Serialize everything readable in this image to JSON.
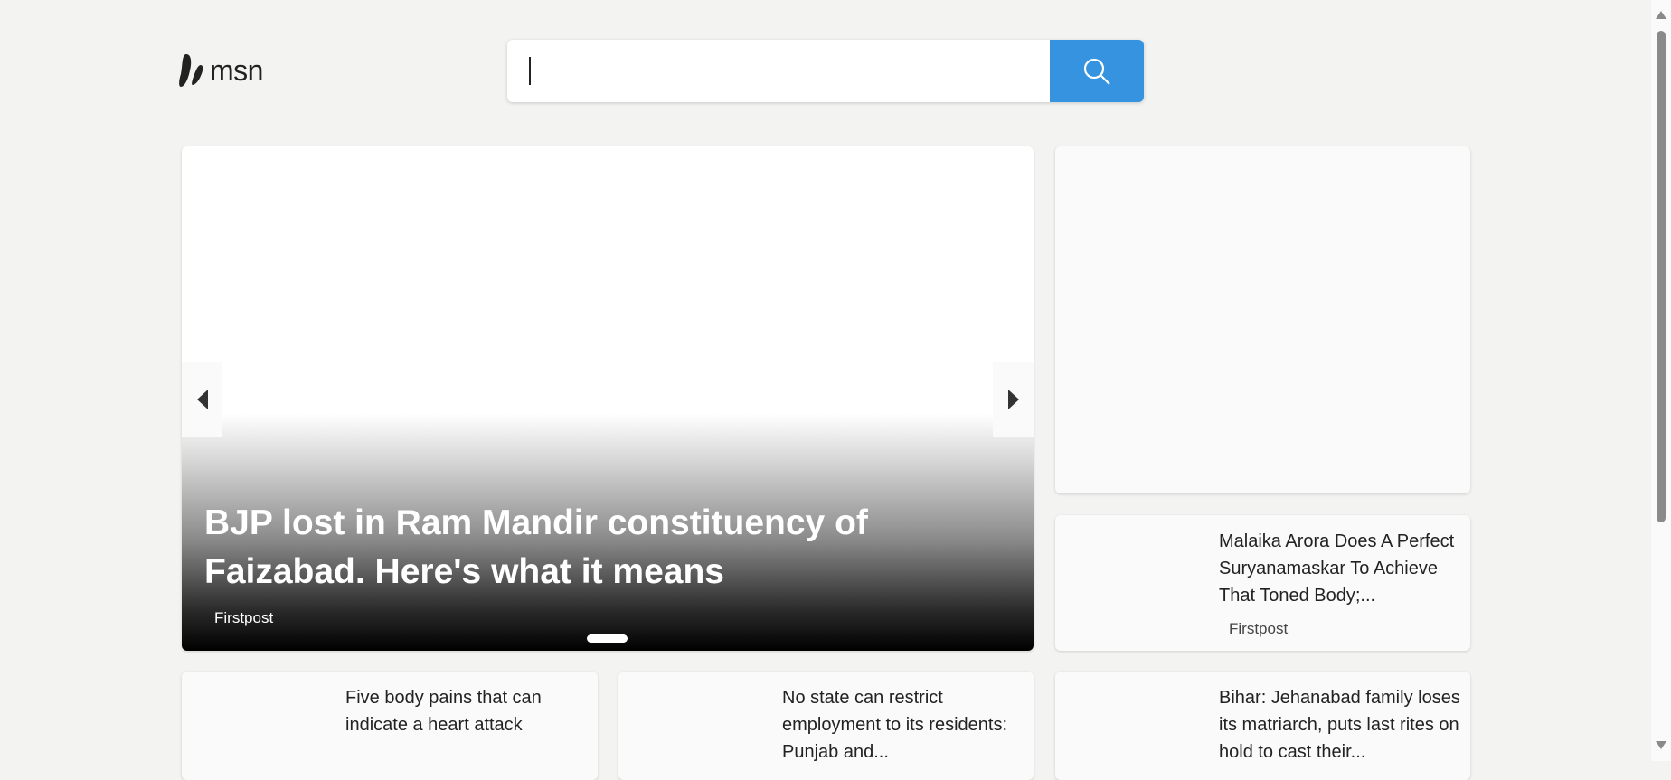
{
  "header": {
    "logo_text": "msn",
    "search": {
      "value": "",
      "placeholder": ""
    }
  },
  "hero": {
    "title": "BJP lost in Ram Mandir constituency of Faizabad. Here's what it means",
    "source": "Firstpost"
  },
  "side_story": {
    "title": "Malaika Arora Does A Perfect Suryanamaskar To Achieve That Toned Body;...",
    "source": "Firstpost"
  },
  "stories": [
    {
      "title": "Five body pains that can indicate a heart attack"
    },
    {
      "title": "No state can restrict employment to its residents: Punjab and..."
    },
    {
      "title": "Bihar: Jehanabad family loses its matriarch, puts last rites on hold to cast their..."
    }
  ],
  "colors": {
    "accent": "#3593e0",
    "background": "#f3f3f2"
  }
}
